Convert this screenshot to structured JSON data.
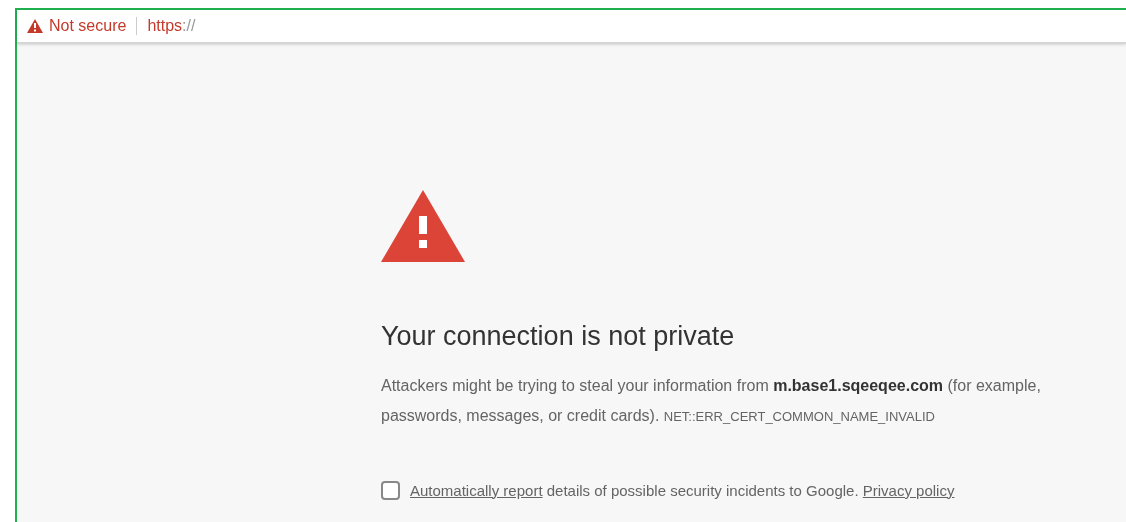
{
  "address_bar": {
    "security_label": "Not secure",
    "scheme": "https",
    "scheme_separator": "://"
  },
  "error_page": {
    "heading": "Your connection is not private",
    "description": "Attackers might be trying to steal your information from **m.base1.sqeeqee.com** (for example, passwords, messages, or credit cards).",
    "error_code": "NET::ERR_CERT_COMMON_NAME_INVALID",
    "report": {
      "checked": false,
      "link": "Automatically report",
      "text": "details of possible security incidents to Google.",
      "privacy_link": "Privacy policy"
    }
  }
}
